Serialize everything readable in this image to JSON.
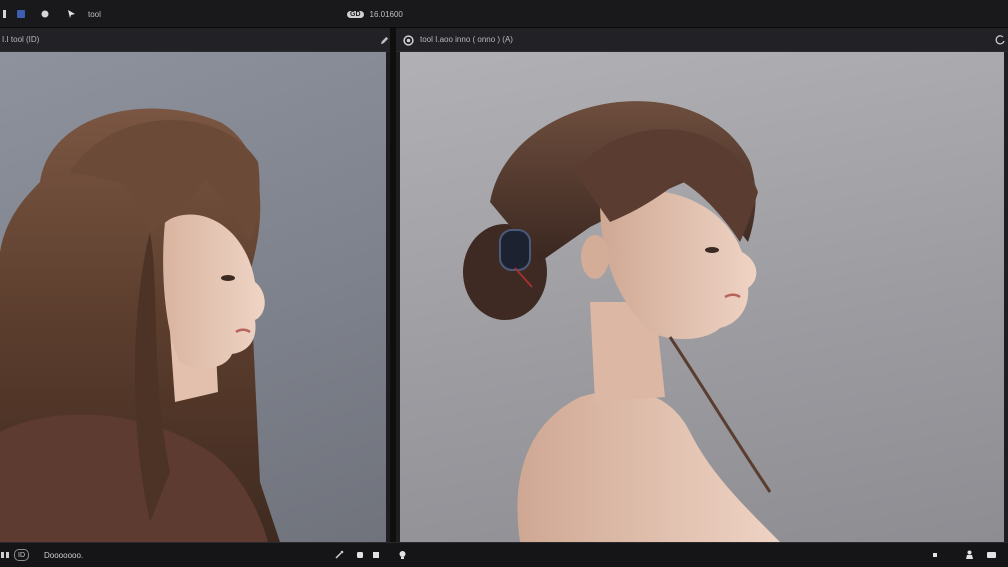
{
  "toolbar": {
    "label_left": "tool",
    "center_badge": "GD",
    "center_text": "16.01600",
    "icons": [
      "info-icon",
      "blue-square-icon",
      "circle-icon",
      "pointer-icon"
    ]
  },
  "left_panel": {
    "title": "I.I tool (ID)",
    "icon": "pencil-icon"
  },
  "right_panel": {
    "title": "tool I.aoo inno ( onno ) (A)",
    "icon": "settings-icon",
    "corner_icon": "refresh-icon"
  },
  "statusbar": {
    "left_badge": "ID",
    "left_text": "Dooooooo.",
    "icons_left": [
      "grid-icon",
      "brush-icon",
      "stop-icon",
      "square-icon"
    ],
    "icons_right": [
      "bulb-icon",
      "dot-icon",
      "figure-icon",
      "chat-icon"
    ]
  },
  "colors": {
    "accent": "#3d5eb0",
    "hair": "#5a3a2a",
    "background": "#141416"
  }
}
